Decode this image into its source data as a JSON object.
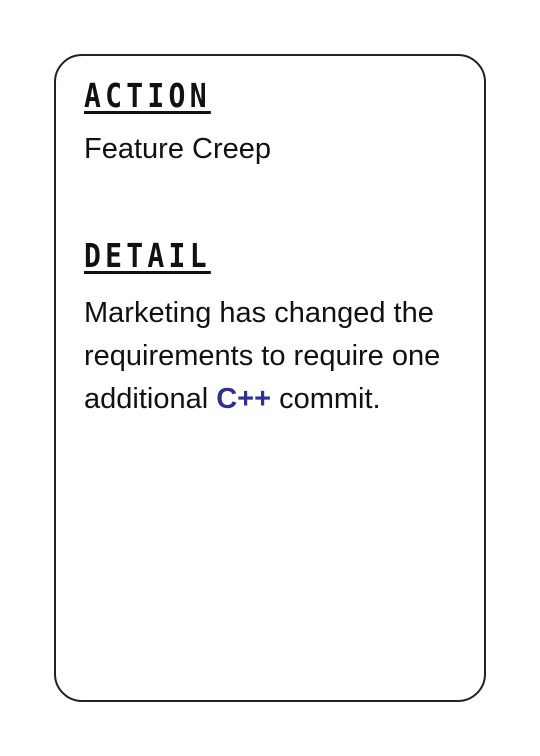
{
  "card": {
    "action_heading": "ACTION",
    "action_text": "Feature Creep",
    "detail_heading": "DETAIL",
    "detail_text_before": "Marketing has changed the requirements to require one additional ",
    "detail_highlight": "C++",
    "detail_text_after": " commit.",
    "highlight_color": "#2e3192"
  }
}
